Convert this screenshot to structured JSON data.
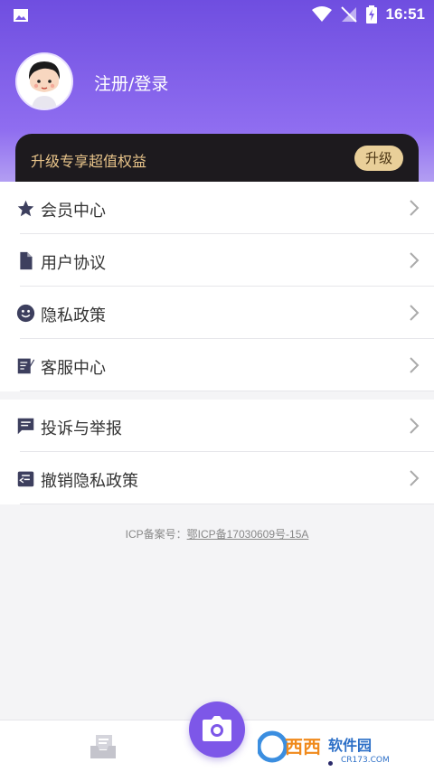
{
  "status_bar": {
    "time": "16:51",
    "icons": [
      "image-icon",
      "wifi-icon",
      "no-signal-icon",
      "battery-charging-icon"
    ]
  },
  "profile": {
    "login_label": "注册/登录",
    "avatar_icon": "avatar-icon"
  },
  "vip": {
    "text": "升级专享超值权益",
    "button_label": "升级"
  },
  "menu": {
    "group1": [
      {
        "label": "会员中心",
        "icon": "star-icon"
      },
      {
        "label": "用户协议",
        "icon": "document-icon"
      },
      {
        "label": "隐私政策",
        "icon": "smiley-icon"
      },
      {
        "label": "客服中心",
        "icon": "edit-note-icon"
      }
    ],
    "group2": [
      {
        "label": "投诉与举报",
        "icon": "chat-icon"
      },
      {
        "label": "撤销隐私政策",
        "icon": "revoke-icon"
      }
    ]
  },
  "icp": {
    "prefix": "ICP备案号：",
    "number": "鄂ICP备17030609号-15A"
  },
  "bottom_nav": {
    "left_icon": "inbox-icon",
    "center_icon": "camera-icon"
  },
  "watermark": {
    "text": "西西软件园",
    "sub": "CR173.COM"
  },
  "colors": {
    "primary": "#7d57e8",
    "vip_bg": "#1d1a1e",
    "vip_text": "#e8c48a",
    "vip_button": "#e9cf99",
    "icon_color": "#3d3f5e"
  }
}
